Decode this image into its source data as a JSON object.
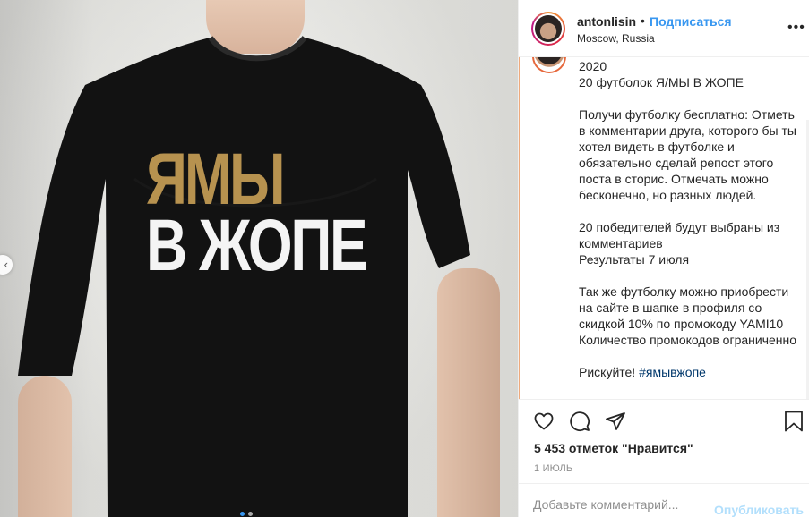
{
  "post": {
    "print_line1": "ЯМЫ",
    "print_line2": "В ЖОПЕ",
    "carousel_prev_glyph": "‹"
  },
  "header": {
    "username": "antonlisin",
    "separator": "•",
    "follow_label": "Подписаться",
    "location": "Moscow, Russia",
    "more_glyph": "•••"
  },
  "caption": {
    "year_line": "2020",
    "title": "20 футболок Я/МЫ В ЖОПЕ",
    "paragraph1": "Получи футболку бесплатно: Отметь в комментарии друга, которого бы ты хотел видеть в футболке и обязательно сделай репост этого поста в сторис. Отмечать можно бесконечно, но разных людей.",
    "paragraph2": "20 победителей будут выбраны из комментариев\nРезультаты 7 июля",
    "paragraph3": "Так же футболку можно приобрести на сайте в шапке в профиля со скидкой 10% по промокоду YAMI10\nКоличество промокодов ограниченно",
    "closing": "Рискуйте!",
    "hashtag": "#ямывжопе"
  },
  "actions": {
    "icons": [
      "heart-icon",
      "comment-icon",
      "share-icon",
      "bookmark-icon"
    ],
    "likes_text": "5 453 отметок \"Нравится\"",
    "date": "1 ИЮЛЬ"
  },
  "comment_box": {
    "placeholder": "Добавьте комментарий...",
    "publish_label": "Опубликовать"
  },
  "colors": {
    "accent": "#3897f0",
    "print_gold": "#b7924f",
    "shirt": "#111111"
  }
}
